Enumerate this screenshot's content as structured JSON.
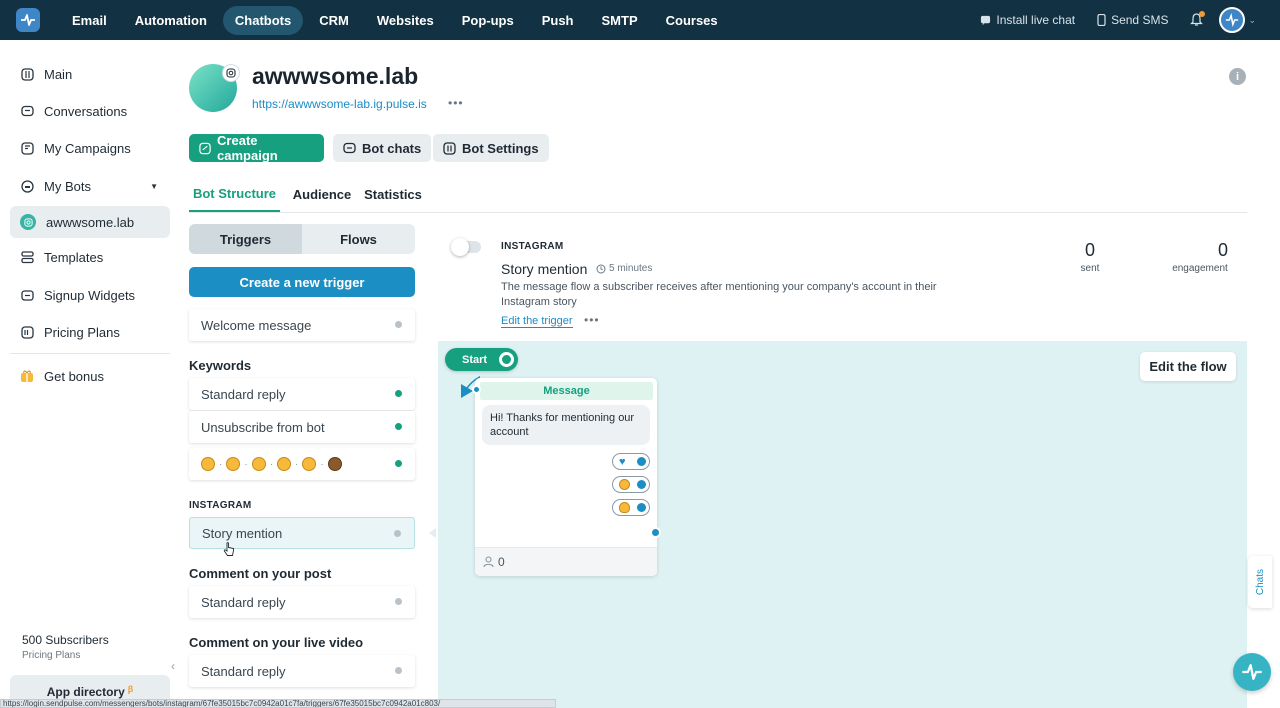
{
  "topnav": {
    "items": [
      "Email",
      "Automation",
      "Chatbots",
      "CRM",
      "Websites",
      "Pop-ups",
      "Push",
      "SMTP",
      "Courses"
    ],
    "active": "Chatbots",
    "install_live_chat": "Install live chat",
    "send_sms": "Send SMS"
  },
  "sidebar": {
    "items": [
      "Main",
      "Conversations",
      "My Campaigns",
      "My Bots",
      "awwwsome.lab",
      "Templates",
      "Signup Widgets",
      "Pricing Plans",
      "Get bonus"
    ],
    "subscribers": "500 Subscribers",
    "plan_link": "Pricing Plans",
    "app_directory": "App directory",
    "beta_mark": "β"
  },
  "header": {
    "title": "awwwsome.lab",
    "url": "https://awwwsome-lab.ig.pulse.is",
    "more": "•••",
    "info": "i"
  },
  "actions": {
    "create_campaign": "Create campaign",
    "bot_chats": "Bot chats",
    "bot_settings": "Bot Settings"
  },
  "tabs": [
    "Bot Structure",
    "Audience",
    "Statistics"
  ],
  "triggers_panel": {
    "seg_triggers": "Triggers",
    "seg_flows": "Flows",
    "create_trigger": "Create a new trigger",
    "welcome": "Welcome message",
    "keywords_label": "Keywords",
    "standard_reply": "Standard reply",
    "unsubscribe": "Unsubscribe from bot",
    "emoji_sep": "·",
    "instagram_label": "INSTAGRAM",
    "story_mention": "Story mention",
    "comment_post_label": "Comment on your post",
    "comment_post_reply": "Standard reply",
    "comment_live_label": "Comment on your live video",
    "comment_live_reply": "Standard reply"
  },
  "trigger_info": {
    "channel": "INSTAGRAM",
    "title": "Story mention",
    "time": "5 minutes",
    "description": "The message flow a subscriber receives after mentioning your company's account in their Instagram story",
    "edit_trigger": "Edit the trigger",
    "more": "•••",
    "sent_value": "0",
    "sent_label": "sent",
    "engagement_value": "0",
    "engagement_label": "engagement"
  },
  "flow": {
    "edit_flow": "Edit the flow",
    "start": "Start",
    "message_header": "Message",
    "message_text": "Hi! Thanks for mentioning our account",
    "subscriber_count": "0"
  },
  "chats_tab": "Chats",
  "status_url": "https://login.sendpulse.com/messengers/bots/instagram/67fe35015bc7c0942a01c7fa/triggers/67fe35015bc7c0942a01c803/",
  "colors": {
    "nav_bg": "#123142",
    "primary_green": "#16a07f",
    "primary_blue": "#1b8fc4",
    "canvas_bg": "#dff2f3"
  }
}
